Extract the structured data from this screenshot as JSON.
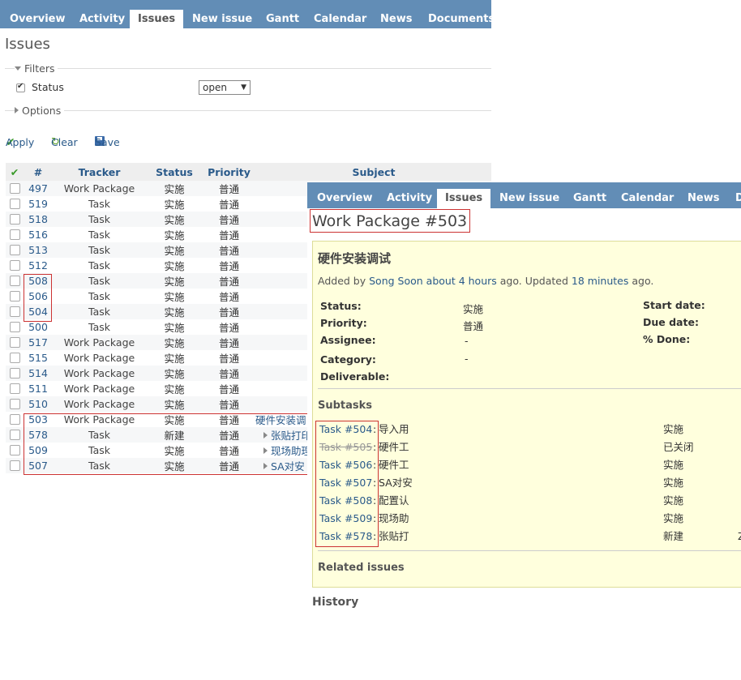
{
  "list_window": {
    "tabs": [
      "Overview",
      "Activity",
      "Issues",
      "New issue",
      "Gantt",
      "Calendar",
      "News",
      "Documents"
    ],
    "page_title": "Issues",
    "filters_legend": "Filters",
    "status_filter_label": "Status",
    "status_filter_value": "open",
    "options_legend": "Options",
    "apply_label": "Apply",
    "clear_label": "Clear",
    "save_label": "Save",
    "columns": {
      "id": "#",
      "tracker": "Tracker",
      "status": "Status",
      "priority": "Priority",
      "subject": "Subject"
    },
    "rows": [
      {
        "id": "497",
        "tracker": "Work Package",
        "status": "实施",
        "priority": "普通",
        "subject": ""
      },
      {
        "id": "519",
        "tracker": "Task",
        "status": "实施",
        "priority": "普通",
        "subject": ""
      },
      {
        "id": "518",
        "tracker": "Task",
        "status": "实施",
        "priority": "普通",
        "subject": ""
      },
      {
        "id": "516",
        "tracker": "Task",
        "status": "实施",
        "priority": "普通",
        "subject": ""
      },
      {
        "id": "513",
        "tracker": "Task",
        "status": "实施",
        "priority": "普通",
        "subject": ""
      },
      {
        "id": "512",
        "tracker": "Task",
        "status": "实施",
        "priority": "普通",
        "subject": ""
      },
      {
        "id": "508",
        "tracker": "Task",
        "status": "实施",
        "priority": "普通",
        "subject": ""
      },
      {
        "id": "506",
        "tracker": "Task",
        "status": "实施",
        "priority": "普通",
        "subject": ""
      },
      {
        "id": "504",
        "tracker": "Task",
        "status": "实施",
        "priority": "普通",
        "subject": ""
      },
      {
        "id": "500",
        "tracker": "Task",
        "status": "实施",
        "priority": "普通",
        "subject": ""
      },
      {
        "id": "517",
        "tracker": "Work Package",
        "status": "实施",
        "priority": "普通",
        "subject": ""
      },
      {
        "id": "515",
        "tracker": "Work Package",
        "status": "实施",
        "priority": "普通",
        "subject": ""
      },
      {
        "id": "514",
        "tracker": "Work Package",
        "status": "实施",
        "priority": "普通",
        "subject": ""
      },
      {
        "id": "511",
        "tracker": "Work Package",
        "status": "实施",
        "priority": "普通",
        "subject": ""
      },
      {
        "id": "510",
        "tracker": "Work Package",
        "status": "实施",
        "priority": "普通",
        "subject": ""
      },
      {
        "id": "503",
        "tracker": "Work Package",
        "status": "实施",
        "priority": "普通",
        "subject": "硬件安装调"
      },
      {
        "id": "578",
        "tracker": "Task",
        "status": "新建",
        "priority": "普通",
        "subject": "张贴打印"
      },
      {
        "id": "509",
        "tracker": "Task",
        "status": "实施",
        "priority": "普通",
        "subject": "现场助理"
      },
      {
        "id": "507",
        "tracker": "Task",
        "status": "实施",
        "priority": "普通",
        "subject": "SA对安"
      }
    ]
  },
  "detail_window": {
    "tabs": [
      "Overview",
      "Activity",
      "Issues",
      "New issue",
      "Gantt",
      "Calendar",
      "News",
      "D"
    ],
    "title": "Work Package #503",
    "subject": "硬件安装调试",
    "author_prefix": "Added by ",
    "author_name": "Song Soon",
    "author_time": "about 4 hours",
    "updated_middle": " ago. Updated ",
    "updated_time": "18 minutes",
    "updated_suffix": " ago.",
    "attributes": {
      "status_label": "Status:",
      "status_value": "实施",
      "priority_label": "Priority:",
      "priority_value": "普通",
      "assignee_label": "Assignee:",
      "assignee_value": "-",
      "category_label": "Category:",
      "category_value": "-",
      "deliverable_label": "Deliverable:",
      "start_label": "Start date:",
      "due_label": "Due date:",
      "done_label": "% Done:"
    },
    "subtasks_heading": "Subtasks",
    "subtasks": [
      {
        "ref": "Task #504",
        "sep": ":",
        "text": "导入用",
        "status": "实施",
        "extra": ""
      },
      {
        "ref": "Task #505",
        "sep": ":",
        "text": "硬件工",
        "status": "已关闭",
        "extra": ""
      },
      {
        "ref": "Task #506",
        "sep": ":",
        "text": "硬件工",
        "status": "实施",
        "extra": ""
      },
      {
        "ref": "Task #507",
        "sep": ":",
        "text": "SA对安",
        "status": "实施",
        "extra": ""
      },
      {
        "ref": "Task #508",
        "sep": ":",
        "text": "配置认",
        "status": "实施",
        "extra": ""
      },
      {
        "ref": "Task #509",
        "sep": ":",
        "text": "现场助",
        "status": "实施",
        "extra": ""
      },
      {
        "ref": "Task #578",
        "sep": ":",
        "text": "张贴打",
        "status": "新建",
        "extra": "Z"
      }
    ],
    "related_heading": "Related issues",
    "history_heading": "History"
  }
}
